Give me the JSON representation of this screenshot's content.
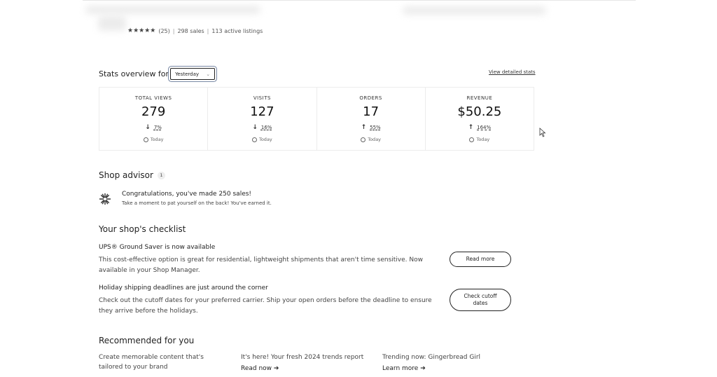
{
  "shop": {
    "stars": "★★★★★",
    "review_count": "(25)",
    "sales": "298 sales",
    "listings": "113 active listings",
    "separator": "|"
  },
  "stats": {
    "title": "Stats overview for",
    "period": "Yesterday",
    "view_detailed": "View detailed stats",
    "items": [
      {
        "label": "TOTAL VIEWS",
        "value": "279",
        "arrow": "↓",
        "change": "7%",
        "period": "Today"
      },
      {
        "label": "VISITS",
        "value": "127",
        "arrow": "↓",
        "change": "16%",
        "period": "Today"
      },
      {
        "label": "ORDERS",
        "value": "17",
        "arrow": "↑",
        "change": "55%",
        "period": "Today"
      },
      {
        "label": "REVENUE",
        "value": "$50.25",
        "arrow": "↑",
        "change": "164%",
        "period": "Today"
      }
    ]
  },
  "advisor": {
    "title": "Shop advisor",
    "count": "1",
    "headline": "Congratulations, you've made 250 sales!",
    "subtext": "Take a moment to pat yourself on the back! You've earned it."
  },
  "checklist": {
    "title": "Your shop's checklist",
    "items": [
      {
        "title": "UPS® Ground Saver is now available",
        "desc": "This cost-effective option is great for residential, lightweight shipments that aren't time sensitive. Now available in your Shop Manager.",
        "button": "Read more"
      },
      {
        "title": "Holiday shipping deadlines are just around the corner",
        "desc": "Check out the cutoff dates for your preferred carrier. Ship your open orders before the deadline to ensure they arrive before the holidays.",
        "button": "Check cutoff dates"
      }
    ]
  },
  "recommended": {
    "title": "Recommended for you",
    "cards": [
      {
        "text": "Create memorable content that's tailored to your brand",
        "link": ""
      },
      {
        "text": "It's here! Your fresh 2024 trends report",
        "link": "Read now ➔"
      },
      {
        "text": "Trending now: Gingerbread Girl",
        "link": "Learn more ➔"
      }
    ]
  }
}
